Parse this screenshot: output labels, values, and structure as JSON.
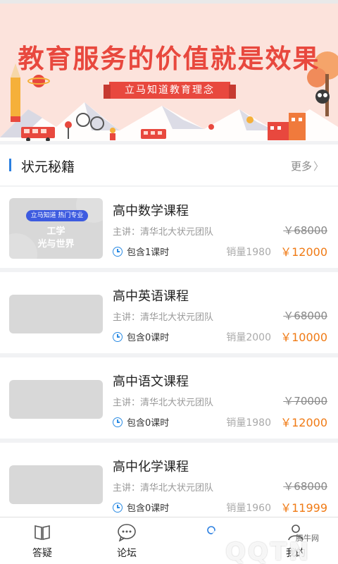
{
  "banner": {
    "title": "教育服务的价值就是效果",
    "subtitle": "立马知道教育理念"
  },
  "section": {
    "title": "状元秘籍",
    "more_label": "更多",
    "accent_color": "#2b7fe0"
  },
  "courses": [
    {
      "name": "高中数学课程",
      "lecturer": "主讲：清华北大状元团队",
      "original_price": "￥68000",
      "hours": "包含1课时",
      "sales": "销量1980",
      "price": "￥12000",
      "thumb": {
        "tag": "立马知道 热门专业",
        "line1": "工学",
        "line2": "光与世界"
      }
    },
    {
      "name": "高中英语课程",
      "lecturer": "主讲：清华北大状元团队",
      "original_price": "￥68000",
      "hours": "包含0课时",
      "sales": "销量2000",
      "price": "￥10000"
    },
    {
      "name": "高中语文课程",
      "lecturer": "主讲：清华北大状元团队",
      "original_price": "￥70000",
      "hours": "包含0课时",
      "sales": "销量1980",
      "price": "￥12000"
    },
    {
      "name": "高中化学课程",
      "lecturer": "主讲：清华北大状元团队",
      "original_price": "￥68000",
      "hours": "包含0课时",
      "sales": "销量1960",
      "price": "￥11999"
    }
  ],
  "price_color": "#f07a14",
  "nav": {
    "items": [
      {
        "label": "答疑",
        "icon": "book-icon"
      },
      {
        "label": "论坛",
        "icon": "chat-bubble-icon"
      },
      {
        "label": "",
        "icon": "center-icon"
      },
      {
        "label": "我的",
        "icon": "user-icon"
      }
    ]
  },
  "watermark": {
    "text": "QQTN",
    "small": "腾牛网"
  }
}
